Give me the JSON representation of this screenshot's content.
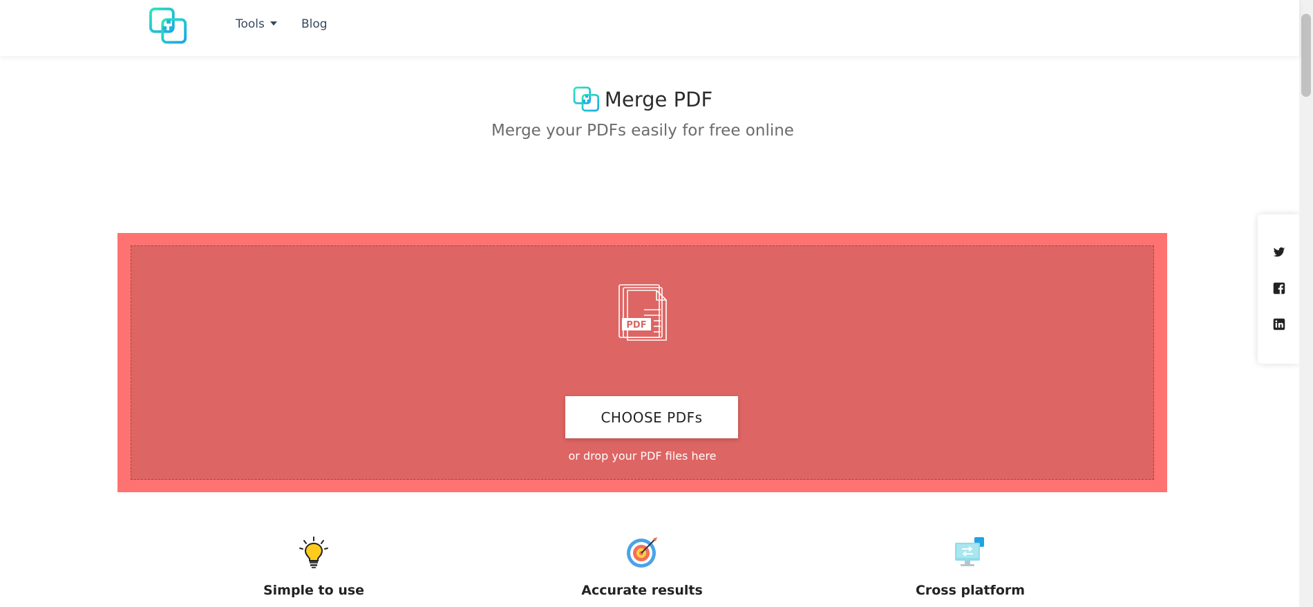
{
  "nav": {
    "tools_label": "Tools",
    "blog_label": "Blog"
  },
  "header": {
    "title": "Merge PDF",
    "subtitle": "Merge your PDFs easily for free online"
  },
  "dropzone": {
    "icon_badge": "PDF",
    "button_label": "CHOOSE PDFs",
    "hint": "or drop your PDF files here"
  },
  "social": [
    "twitter-icon",
    "facebook-icon",
    "linkedin-icon"
  ],
  "features": [
    {
      "title": "Simple to use",
      "icon": "lightbulb-icon"
    },
    {
      "title": "Accurate results",
      "icon": "target-icon"
    },
    {
      "title": "Cross platform",
      "icon": "devices-icon"
    }
  ],
  "colors": {
    "dropzone_outer": "#fe7371",
    "dropzone_inner": "#dd6563",
    "logo_gradient_start": "#2ee6b8",
    "logo_gradient_end": "#1aa6e8"
  }
}
